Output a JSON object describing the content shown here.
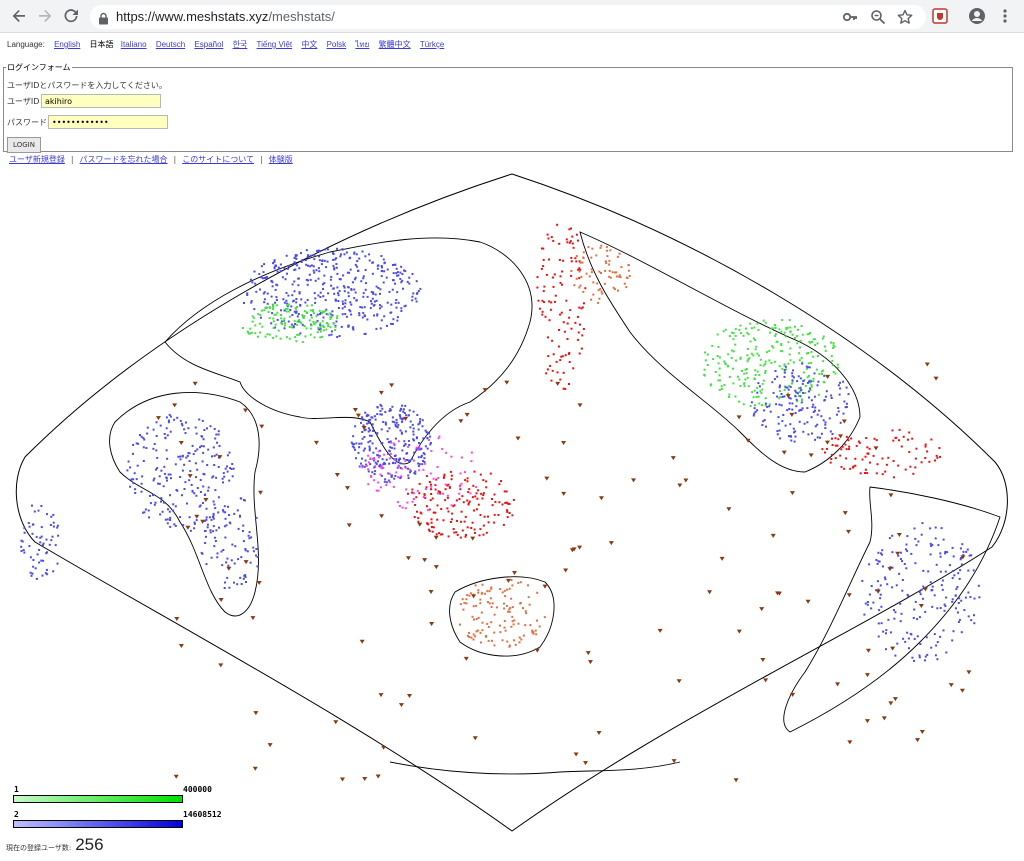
{
  "browser": {
    "url_host": "https://www.meshstats.xyz",
    "url_path": "/meshstats/"
  },
  "language_bar": {
    "label": "Language:",
    "current": "日本語",
    "links": [
      "English",
      "Italiano",
      "Deutsch",
      "Español",
      "한국",
      "Tiếng Việt",
      "中文",
      "Polsk",
      "ไทย",
      "繁體中文",
      "Türkçe"
    ]
  },
  "login_form": {
    "legend": "ログインフォーム",
    "description": "ユーザIDとパスワードを入力してください。",
    "user_id_label": "ユーザID",
    "user_id_value": "akihiro",
    "password_label": "パスワード",
    "password_value": "••••••••••••",
    "login_button": "LOGIN"
  },
  "footer_links": {
    "register": "ユーザ新規登録",
    "forgot_password": "パスワードを忘れた場合",
    "about": "このサイトについて",
    "trial": "体験版"
  },
  "legend": {
    "row1_start": "1",
    "row1_end": "400000",
    "row1_colors": [
      "#c8f8c8",
      "#00e000"
    ],
    "row2_start": "2",
    "row2_end": "14608512",
    "row2_colors": [
      "#c0c0ff",
      "#0000e0"
    ]
  },
  "user_count": {
    "label": "現在の登録ユーザ数:",
    "value": "256"
  },
  "map_colors": {
    "blue_points": "#4a4af0",
    "green_points": "#44e044",
    "red_points": "#ee1010",
    "pink_points": "#ff44ee",
    "orange_points": "#e07040",
    "brown_triangles": "#8b3a0f"
  }
}
